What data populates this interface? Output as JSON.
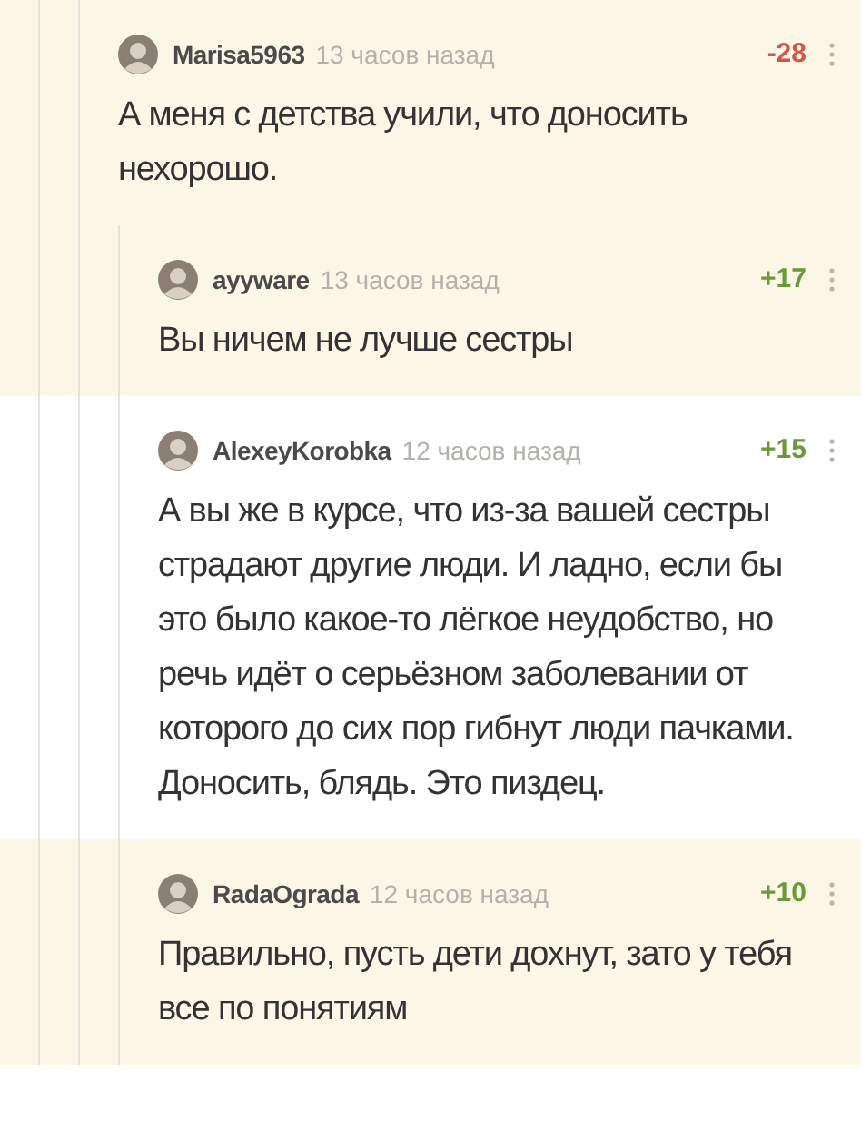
{
  "comments": [
    {
      "author": "Marisa5963",
      "time": "13 часов назад",
      "rating": {
        "value": "-28",
        "color": "#d0574a"
      },
      "highlighted": true,
      "text": "А меня с детства учили, что доносить нехорошо.",
      "children": [
        {
          "author": "ayyware",
          "time": "13 часов назад",
          "rating": {
            "value": "+17",
            "color": "#6b9a3a"
          },
          "highlighted": true,
          "text": "Вы ничем не лучше сестры"
        },
        {
          "author": "AlexeyKorobka",
          "time": "12 часов назад",
          "rating": {
            "value": "+15",
            "color": "#6b9a3a"
          },
          "highlighted": false,
          "text": "А вы же в курсе, что из-за вашей сестры страдают другие люди. И ладно, если бы это было какое-то лёгкое неудобство, но речь идёт о серьёзном заболевании от которого до сих пор гибнут люди пачками. Доносить, блядь. Это пиздец."
        },
        {
          "author": "RadaOgrada",
          "time": "12 часов назад",
          "rating": {
            "value": "+10",
            "color": "#6b9a3a"
          },
          "highlighted": true,
          "text": "Правильно, пусть дети дохнут, зато у тебя все по понятиям"
        }
      ]
    }
  ]
}
